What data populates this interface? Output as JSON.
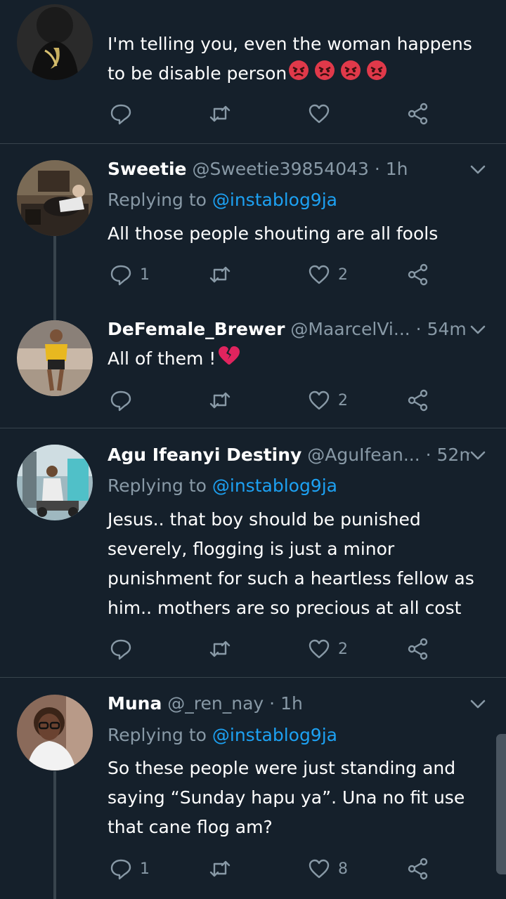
{
  "tweets": [
    {
      "text": "I'm telling you, even the woman happens to be disable person",
      "emoji": [
        "angry-face",
        "angry-face",
        "angry-face",
        "angry-face"
      ],
      "reply_count": "",
      "like_count": ""
    },
    {
      "name": "Sweetie",
      "handle": "@Sweetie39854043",
      "sep": " · ",
      "time": "1h",
      "replying_prefix": "Replying to ",
      "replying_to": "@instablog9ja",
      "text": "All those people shouting are all fools",
      "reply_count": "1",
      "like_count": "2"
    },
    {
      "name": "DeFemale_Brewer",
      "handle": "@MaarcelVi...",
      "sep": " · ",
      "time": "54m",
      "text": "All of them !",
      "emoji": [
        "broken-heart"
      ],
      "reply_count": "",
      "like_count": "2"
    },
    {
      "name": "Agu Ifeanyi Destiny",
      "handle": "@AguIfean...",
      "sep": " · ",
      "time": "52m",
      "replying_prefix": "Replying to ",
      "replying_to": "@instablog9ja",
      "text": "Jesus.. that boy should be punished severely, flogging is just a minor punishment for such a heartless fellow as him.. mothers are so precious at all cost",
      "reply_count": "",
      "like_count": "2"
    },
    {
      "name": "Muna",
      "handle": "@_ren_nay",
      "sep": " · ",
      "time": "1h",
      "replying_prefix": "Replying to ",
      "replying_to": "@instablog9ja",
      "text": "So these people were just standing and saying “Sunday hapu ya”. Una no fit use that cane flog am?",
      "reply_count": "1",
      "like_count": "8"
    }
  ],
  "icons": {
    "reply": "reply-icon",
    "retweet": "retweet-icon",
    "like": "like-icon",
    "share": "share-icon",
    "more": "chevron-down-icon"
  },
  "colors": {
    "background": "#15202b",
    "text": "#ffffff",
    "secondary": "#8899a6",
    "link": "#1da1f2",
    "divider": "#38444d"
  }
}
